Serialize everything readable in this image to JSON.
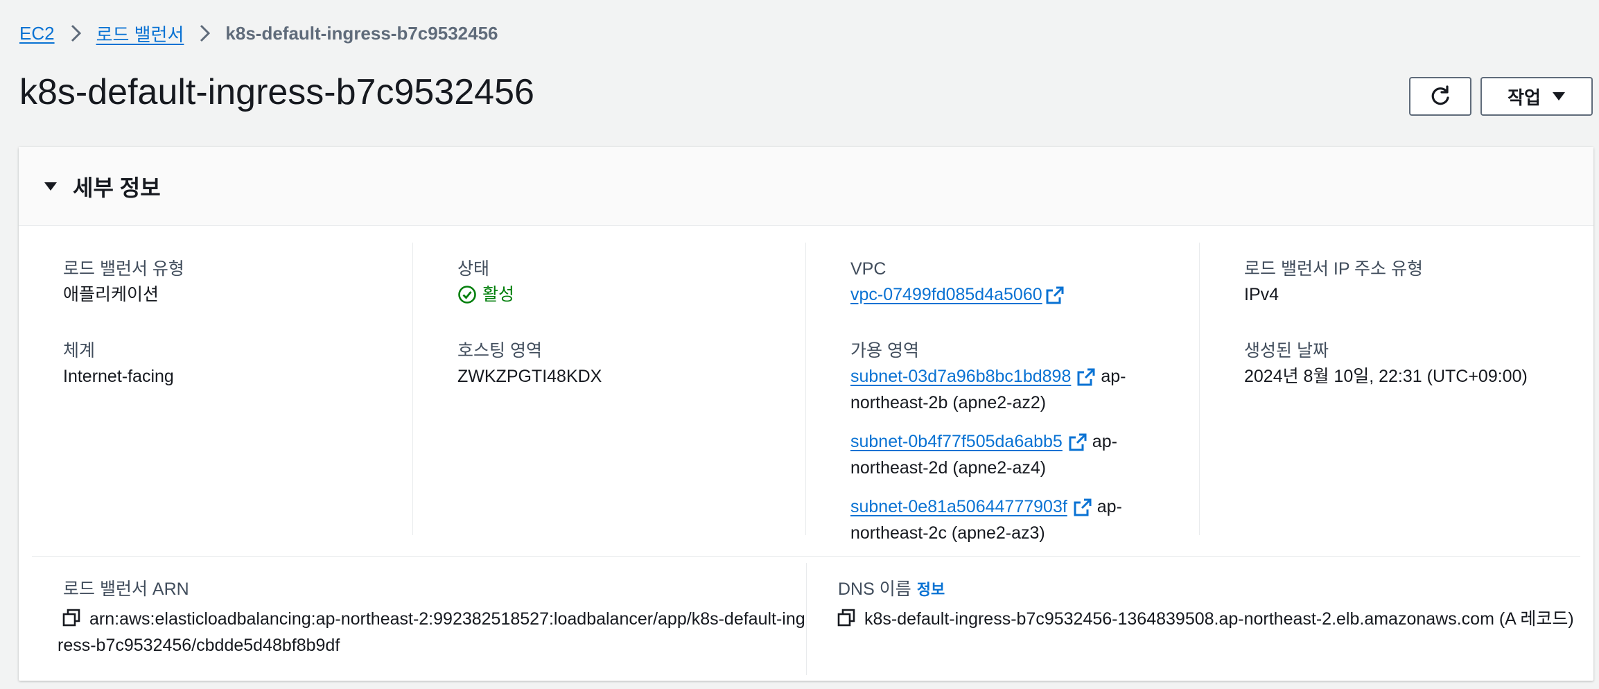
{
  "breadcrumb": {
    "items": [
      "EC2",
      "로드 밸런서"
    ],
    "current": "k8s-default-ingress-b7c9532456"
  },
  "page": {
    "title": "k8s-default-ingress-b7c9532456",
    "actions_label": "작업"
  },
  "details": {
    "section_title": "세부 정보",
    "lb_type_label": "로드 밸런서 유형",
    "lb_type_value": "애플리케이션",
    "scheme_label": "체계",
    "scheme_value": "Internet-facing",
    "status_label": "상태",
    "status_value": "활성",
    "hosted_zone_label": "호스팅 영역",
    "hosted_zone_value": "ZWKZPGTI48KDX",
    "vpc_label": "VPC",
    "vpc_value": "vpc-07499fd085d4a5060",
    "az_label": "가용 영역",
    "subnets": [
      {
        "id": "subnet-03d7a96b8bc1bd898",
        "zone": "ap-northeast-2b (apne2-az2)"
      },
      {
        "id": "subnet-0b4f77f505da6abb5",
        "zone": "ap-northeast-2d (apne2-az4)"
      },
      {
        "id": "subnet-0e81a50644777903f",
        "zone": "ap-northeast-2c (apne2-az3)"
      }
    ],
    "ip_type_label": "로드 밸런서 IP 주소 유형",
    "ip_type_value": "IPv4",
    "created_label": "생성된 날짜",
    "created_value": "2024년 8월 10일, 22:31 (UTC+09:00)",
    "arn_label": "로드 밸런서 ARN",
    "arn_value": "arn:aws:elasticloadbalancing:ap-northeast-2:992382518527:loadbalancer/app/k8s-default-ingress-b7c9532456/cbdde5d48bf8b9df",
    "dns_label": "DNS 이름",
    "dns_info_label": "정보",
    "dns_value": "k8s-default-ingress-b7c9532456-1364839508.ap-northeast-2.elb.amazonaws.com (A 레코드)"
  },
  "colors": {
    "link": "#0972d3",
    "success": "#037f0c",
    "background": "#f2f3f3"
  },
  "icons": [
    "chevron-right-icon",
    "refresh-icon",
    "caret-down-icon",
    "check-circle-icon",
    "external-link-icon",
    "copy-icon"
  ]
}
